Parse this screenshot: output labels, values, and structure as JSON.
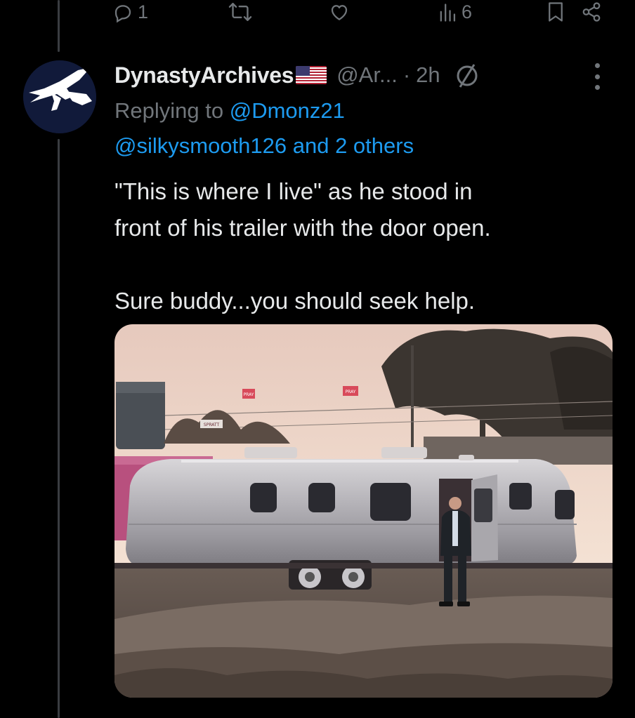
{
  "actions": {
    "reply_count": "1",
    "retweet_count": "",
    "like_count": "",
    "views_count": "6"
  },
  "tweet": {
    "display_name": "DynastyArchives",
    "handle": "@Ar...",
    "separator": "·",
    "time": "2h",
    "replying_prefix": "Replying to",
    "replying_to": "@Dmonz21",
    "replying_others": "@silkysmooth126 and 2 others",
    "text_line_1": "\"This is where I live\" as he stood in",
    "text_line_2": "front of his trailer with the door open.",
    "text_line_3": "Sure buddy...you should seek help."
  },
  "media": {
    "sign_1": "PRAY",
    "sign_2": "PRAY",
    "sign_3": "SPRATT"
  },
  "icons": {
    "reply": "reply-icon",
    "retweet": "retweet-icon",
    "like": "heart-icon",
    "views": "views-icon",
    "bookmark": "bookmark-icon",
    "share": "share-icon",
    "flag": "us-flag-icon",
    "no_sign": "no-sign-icon",
    "more": "more-icon"
  },
  "colors": {
    "background": "#000000",
    "text": "#e7e9ea",
    "muted": "#71767b",
    "link": "#1d9bf0",
    "avatar_bg": "#111a3a"
  }
}
